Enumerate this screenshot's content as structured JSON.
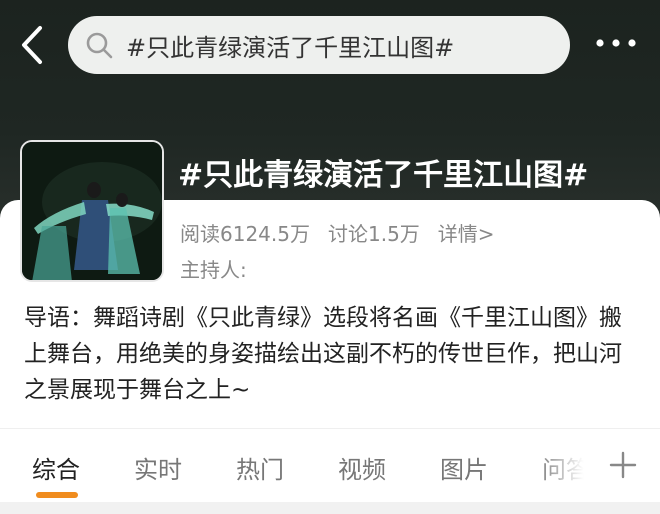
{
  "header": {
    "search_query": "#只此青绿演活了千里江山图#",
    "back_icon": "chevron-left-icon",
    "more_icon": "more-dots-icon"
  },
  "topic": {
    "title": "#只此青绿演活了千里江山图#",
    "reads": "阅读6124.5万",
    "discussions": "讨论1.5万",
    "details": "详情>",
    "host": "主持人:"
  },
  "intro": {
    "text": "导语：舞蹈诗剧《只此青绿》选段将名画《千里江山图》搬上舞台，用绝美的身姿描绘出这副不朽的传世巨作，把山河之景展现于舞台之上~"
  },
  "tabs": [
    {
      "label": "综合"
    },
    {
      "label": "实时"
    },
    {
      "label": "热门"
    },
    {
      "label": "视频"
    },
    {
      "label": "图片"
    },
    {
      "label": "问答"
    }
  ],
  "colors": {
    "accent": "#f08c1e",
    "header_bg": "#1f2723"
  }
}
